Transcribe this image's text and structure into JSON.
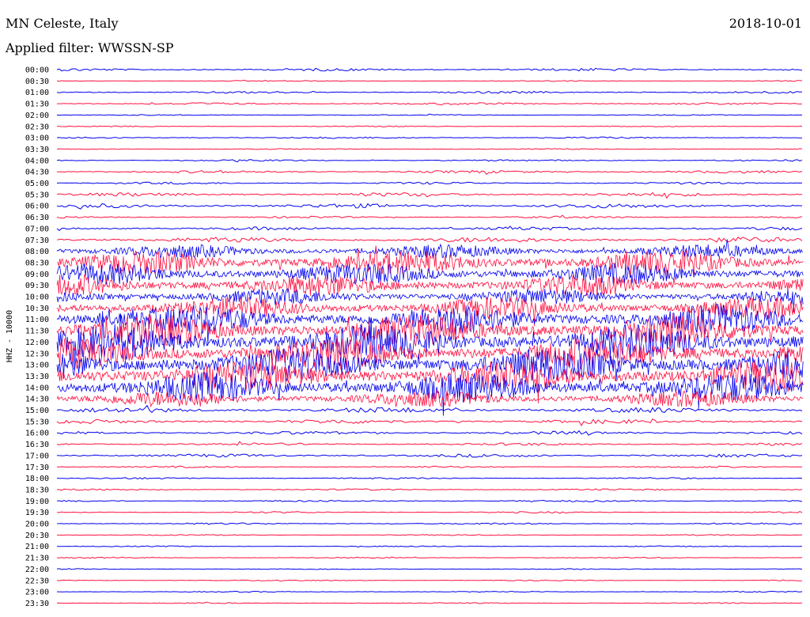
{
  "header": {
    "station": "MN Celeste, Italy",
    "date": "2018-10-01",
    "filter": "Applied filter: WWSSN-SP"
  },
  "chart_data": {
    "type": "line",
    "title": "MN Celeste, Italy",
    "subtitle": "Applied filter: WWSSN-SP",
    "date": "2018-10-01",
    "ylabel": "HHZ - 10000",
    "xlabel": "",
    "grid": false,
    "colors": {
      "odd_rows": "#0000ee",
      "even_rows": "#ff1040"
    },
    "rows": [
      {
        "label": "00:00",
        "amplitude": 0.05
      },
      {
        "label": "00:30",
        "amplitude": 0.02
      },
      {
        "label": "01:00",
        "amplitude": 0.04
      },
      {
        "label": "01:30",
        "amplitude": 0.04
      },
      {
        "label": "02:00",
        "amplitude": 0.02
      },
      {
        "label": "02:30",
        "amplitude": 0.02
      },
      {
        "label": "03:00",
        "amplitude": 0.03
      },
      {
        "label": "03:30",
        "amplitude": 0.02
      },
      {
        "label": "04:00",
        "amplitude": 0.03
      },
      {
        "label": "04:30",
        "amplitude": 0.05
      },
      {
        "label": "05:00",
        "amplitude": 0.04
      },
      {
        "label": "05:30",
        "amplitude": 0.07
      },
      {
        "label": "06:00",
        "amplitude": 0.08
      },
      {
        "label": "06:30",
        "amplitude": 0.04
      },
      {
        "label": "07:00",
        "amplitude": 0.06
      },
      {
        "label": "07:30",
        "amplitude": 0.1
      },
      {
        "label": "08:00",
        "amplitude": 0.25
      },
      {
        "label": "08:30",
        "amplitude": 0.45
      },
      {
        "label": "09:00",
        "amplitude": 0.4
      },
      {
        "label": "09:30",
        "amplitude": 0.4
      },
      {
        "label": "10:00",
        "amplitude": 0.3
      },
      {
        "label": "10:30",
        "amplitude": 0.4
      },
      {
        "label": "11:00",
        "amplitude": 0.55
      },
      {
        "label": "11:30",
        "amplitude": 0.6
      },
      {
        "label": "12:00",
        "amplitude": 0.65
      },
      {
        "label": "12:30",
        "amplitude": 0.6
      },
      {
        "label": "13:00",
        "amplitude": 0.65
      },
      {
        "label": "13:30",
        "amplitude": 0.6
      },
      {
        "label": "14:00",
        "amplitude": 0.55
      },
      {
        "label": "14:30",
        "amplitude": 0.3
      },
      {
        "label": "15:00",
        "amplitude": 0.1
      },
      {
        "label": "15:30",
        "amplitude": 0.08
      },
      {
        "label": "16:00",
        "amplitude": 0.06
      },
      {
        "label": "16:30",
        "amplitude": 0.05
      },
      {
        "label": "17:00",
        "amplitude": 0.06
      },
      {
        "label": "17:30",
        "amplitude": 0.03
      },
      {
        "label": "18:00",
        "amplitude": 0.03
      },
      {
        "label": "18:30",
        "amplitude": 0.03
      },
      {
        "label": "19:00",
        "amplitude": 0.03
      },
      {
        "label": "19:30",
        "amplitude": 0.03
      },
      {
        "label": "20:00",
        "amplitude": 0.03
      },
      {
        "label": "20:30",
        "amplitude": 0.02
      },
      {
        "label": "21:00",
        "amplitude": 0.02
      },
      {
        "label": "21:30",
        "amplitude": 0.02
      },
      {
        "label": "22:00",
        "amplitude": 0.02
      },
      {
        "label": "22:30",
        "amplitude": 0.02
      },
      {
        "label": "23:00",
        "amplitude": 0.02
      },
      {
        "label": "23:30",
        "amplitude": 0.02
      }
    ]
  }
}
